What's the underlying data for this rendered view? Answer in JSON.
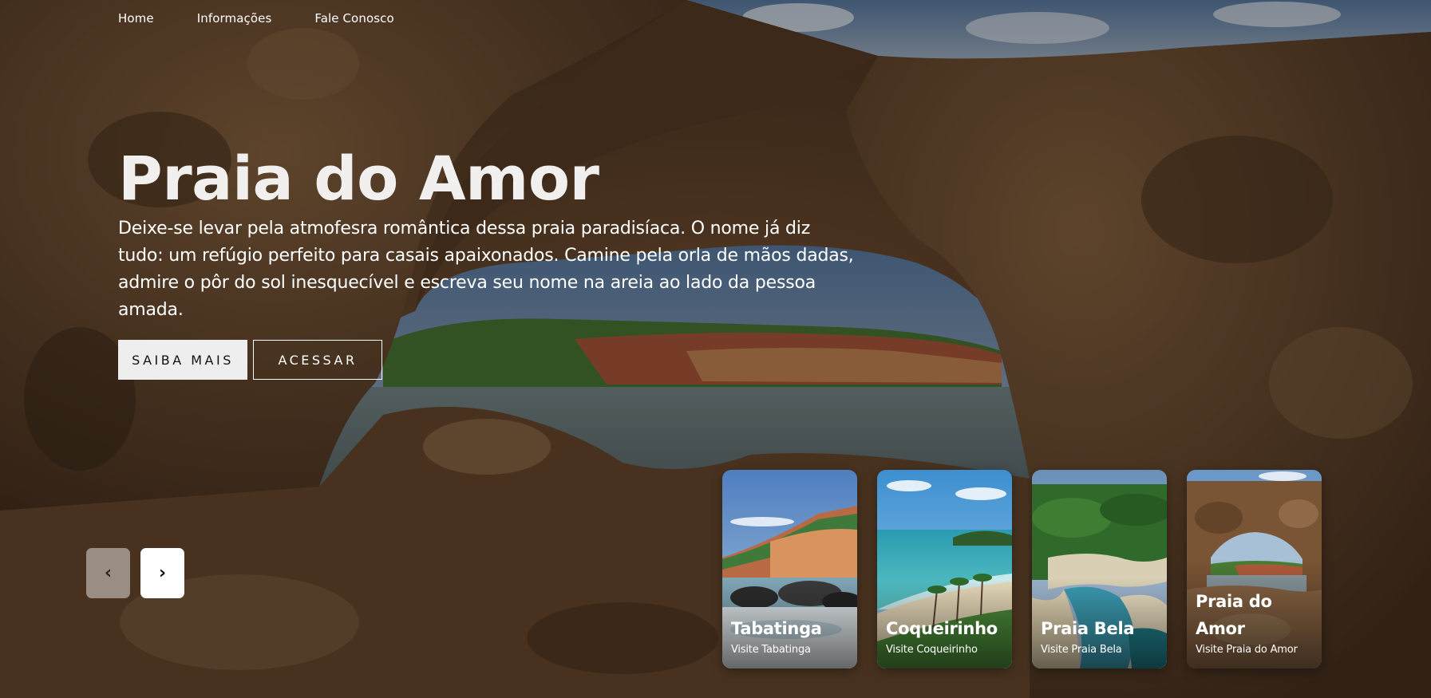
{
  "nav": {
    "items": [
      "Home",
      "Informações",
      "Fale Conosco"
    ]
  },
  "hero": {
    "title": "Praia do Amor",
    "description": "Deixe-se levar pela atmofesra romântica dessa praia paradisíaca. O nome já diz tudo: um refúgio perfeito para casais apaixonados. Camine pela orla de mãos dadas, admire o pôr do sol inesquecível e escreva seu nome na areia ao lado da pessoa amada.",
    "primary_button": "SAIBA MAIS",
    "secondary_button": "ACESSAR"
  },
  "slider": {
    "prev_icon": "‹",
    "next_icon": "›"
  },
  "cards": [
    {
      "title": "Tabatinga",
      "subtitle": "Visite Tabatinga",
      "image": "cliff-beach"
    },
    {
      "title": "Coqueirinho",
      "subtitle": "Visite Coqueirinho",
      "image": "palm-beach"
    },
    {
      "title": "Praia Bela",
      "subtitle": "Visite Praia Bela",
      "image": "river-mouth"
    },
    {
      "title": "Praia do Amor",
      "subtitle": "Visite Praia do Amor",
      "image": "rock-arch"
    }
  ],
  "colors": {
    "accent_light": "#eeeeee",
    "text_light": "#ffffff",
    "rock_brown": "#6b4a2e"
  }
}
